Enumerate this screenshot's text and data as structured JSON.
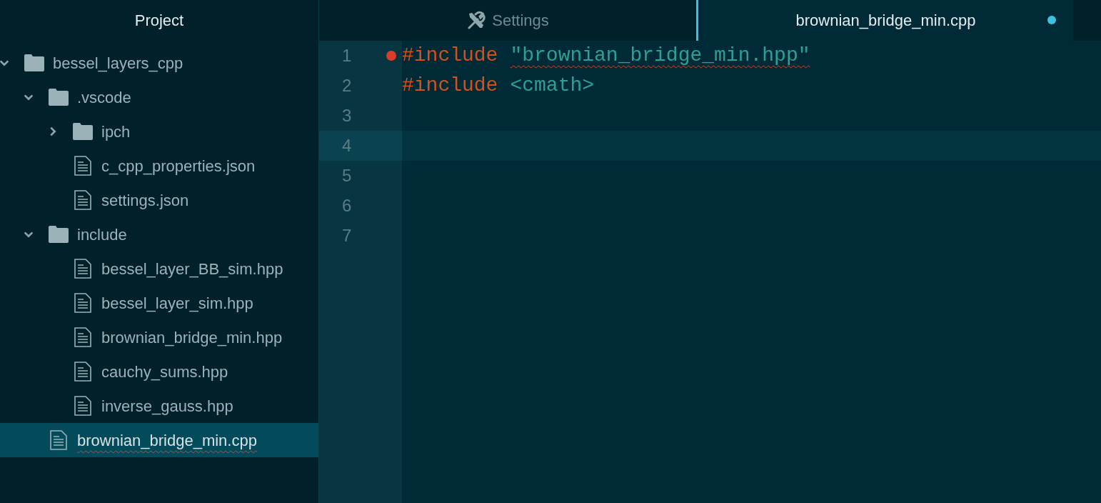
{
  "sidebar": {
    "title": "Project",
    "tree": [
      {
        "kind": "folder",
        "name": "bessel_layers_cpp",
        "expanded": true,
        "selected": false,
        "error": false,
        "children": [
          {
            "kind": "folder",
            "name": ".vscode",
            "expanded": true,
            "selected": false,
            "error": false,
            "children": [
              {
                "kind": "folder",
                "name": "ipch",
                "expanded": false,
                "selected": false,
                "error": false
              },
              {
                "kind": "file",
                "name": "c_cpp_properties.json",
                "selected": false,
                "error": false
              },
              {
                "kind": "file",
                "name": "settings.json",
                "selected": false,
                "error": false
              }
            ]
          },
          {
            "kind": "folder",
            "name": "include",
            "expanded": true,
            "selected": false,
            "error": false,
            "children": [
              {
                "kind": "file",
                "name": "bessel_layer_BB_sim.hpp",
                "selected": false,
                "error": false
              },
              {
                "kind": "file",
                "name": "bessel_layer_sim.hpp",
                "selected": false,
                "error": false
              },
              {
                "kind": "file",
                "name": "brownian_bridge_min.hpp",
                "selected": false,
                "error": false
              },
              {
                "kind": "file",
                "name": "cauchy_sums.hpp",
                "selected": false,
                "error": false
              },
              {
                "kind": "file",
                "name": "inverse_gauss.hpp",
                "selected": false,
                "error": false
              }
            ]
          },
          {
            "kind": "file",
            "name": "brownian_bridge_min.cpp",
            "selected": true,
            "error": true
          }
        ]
      }
    ]
  },
  "tabs": [
    {
      "kind": "settings",
      "label": "Settings",
      "selected": false,
      "modified": false
    },
    {
      "kind": "file",
      "label": "brownian_bridge_min.cpp",
      "selected": true,
      "modified": true
    }
  ],
  "editor": {
    "lines": [
      {
        "number": "1",
        "breakpoint": true,
        "current": false,
        "tokens": [
          {
            "kind": "keyword",
            "text": "#include",
            "error": false
          },
          {
            "kind": "string",
            "text": "\"brownian_bridge_min.hpp\"",
            "error": true
          }
        ]
      },
      {
        "number": "2",
        "breakpoint": false,
        "current": false,
        "tokens": [
          {
            "kind": "keyword",
            "text": "#include",
            "error": false
          },
          {
            "kind": "string",
            "text": "<cmath>",
            "error": false
          }
        ]
      },
      {
        "number": "3",
        "breakpoint": false,
        "current": false
      },
      {
        "number": "4",
        "breakpoint": false,
        "current": true
      },
      {
        "number": "5",
        "breakpoint": false,
        "current": false
      },
      {
        "number": "6",
        "breakpoint": false,
        "current": false
      },
      {
        "number": "7",
        "breakpoint": false,
        "current": false
      }
    ]
  }
}
